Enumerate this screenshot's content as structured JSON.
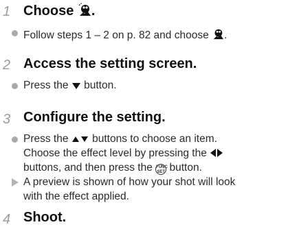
{
  "steps": [
    {
      "number": "1",
      "title": "Choose",
      "title_icon": "fisheye-effect-icon",
      "lines": [
        {
          "type": "bullet",
          "text_before": "Follow steps 1 – 2 on p. 82 and choose",
          "icon": "fisheye-effect-icon",
          "text_after": "."
        }
      ]
    },
    {
      "number": "2",
      "title": "Access the setting screen.",
      "lines": [
        {
          "type": "bullet",
          "text_before": "Press the",
          "icon": "down-arrow-icon",
          "text_after": "button."
        }
      ]
    },
    {
      "number": "3",
      "title": "Configure the setting.",
      "lines": [
        {
          "type": "bullet",
          "text_before": "Press the",
          "icon": "up-down-arrows-icon",
          "text_after": "buttons to choose an item."
        },
        {
          "type": "cont",
          "text_before": "Choose the effect level by pressing the",
          "icon": "left-right-arrows-icon",
          "text_after": ""
        },
        {
          "type": "cont",
          "text_before": "buttons, and then press the",
          "icon": "func-set-button-icon",
          "text_after": "button.",
          "func_label_1": "FUNC",
          "func_label_2": "SET"
        },
        {
          "type": "result",
          "text": "A preview is shown of how your shot will look"
        },
        {
          "type": "cont",
          "text": "with the effect applied."
        }
      ]
    },
    {
      "number": "4",
      "title": "Shoot."
    }
  ],
  "colors": {
    "step_number": "#9c9c9c",
    "bullet": "#a9a9a9",
    "result_marker": "#b3b3b3"
  }
}
